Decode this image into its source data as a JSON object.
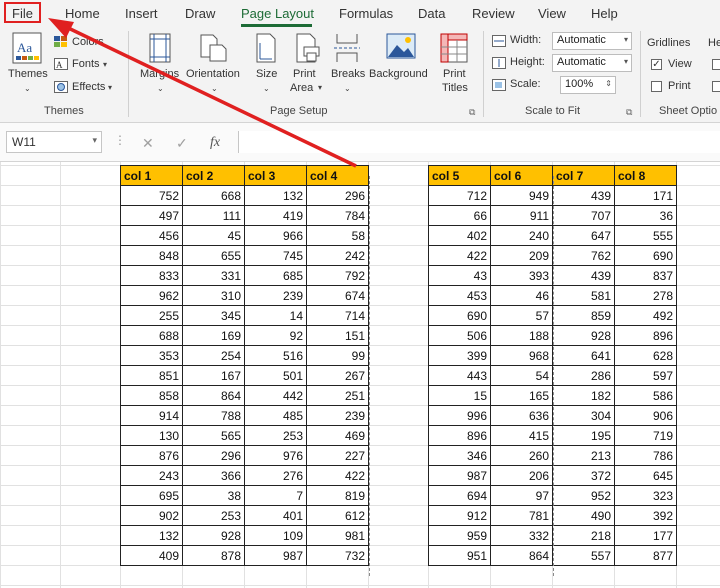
{
  "menu": {
    "file": "File",
    "tabs": [
      "Home",
      "Insert",
      "Draw",
      "Page Layout",
      "Formulas",
      "Data",
      "Review",
      "View",
      "Help"
    ],
    "active": "Page Layout"
  },
  "ribbon": {
    "themes_group": {
      "themes": "Themes",
      "colors": "Colors",
      "fonts": "Fonts",
      "effects": "Effects",
      "label": "Themes"
    },
    "page_setup": {
      "margins": "Margins",
      "orientation": "Orientation",
      "size": "Size",
      "print_area_1": "Print",
      "print_area_2": "Area",
      "breaks": "Breaks",
      "background": "Background",
      "print_titles_1": "Print",
      "print_titles_2": "Titles",
      "label": "Page Setup"
    },
    "scale_to_fit": {
      "width_label": "Width:",
      "width_value": "Automatic",
      "height_label": "Height:",
      "height_value": "Automatic",
      "scale_label": "Scale:",
      "scale_value": "100%",
      "label": "Scale to Fit"
    },
    "sheet_options": {
      "gridlines": "Gridlines",
      "headings_partial": "He",
      "view": "View",
      "print": "Print",
      "label": "Sheet Optio"
    }
  },
  "formula_bar": {
    "name_box": "W11",
    "cancel": "✕",
    "enter": "✓",
    "fx": "fx"
  },
  "table1": {
    "headers": [
      "col 1",
      "col 2",
      "col 3",
      "col 4"
    ],
    "rows": [
      [
        752,
        668,
        132,
        296
      ],
      [
        497,
        111,
        419,
        784
      ],
      [
        456,
        45,
        966,
        58
      ],
      [
        848,
        655,
        745,
        242
      ],
      [
        833,
        331,
        685,
        792
      ],
      [
        962,
        310,
        239,
        674
      ],
      [
        255,
        345,
        14,
        714
      ],
      [
        688,
        169,
        92,
        151
      ],
      [
        353,
        254,
        516,
        99
      ],
      [
        851,
        167,
        501,
        267
      ],
      [
        858,
        864,
        442,
        251
      ],
      [
        914,
        788,
        485,
        239
      ],
      [
        130,
        565,
        253,
        469
      ],
      [
        876,
        296,
        976,
        227
      ],
      [
        243,
        366,
        276,
        422
      ],
      [
        695,
        38,
        7,
        819
      ],
      [
        902,
        253,
        401,
        612
      ],
      [
        132,
        928,
        109,
        981
      ],
      [
        409,
        878,
        987,
        732
      ]
    ]
  },
  "table2": {
    "headers": [
      "col 5",
      "col 6",
      "col 7",
      "col 8"
    ],
    "rows": [
      [
        712,
        949,
        439,
        171
      ],
      [
        66,
        911,
        707,
        36
      ],
      [
        402,
        240,
        647,
        555
      ],
      [
        422,
        209,
        762,
        690
      ],
      [
        43,
        393,
        439,
        837
      ],
      [
        453,
        46,
        581,
        278
      ],
      [
        690,
        57,
        859,
        492
      ],
      [
        506,
        188,
        928,
        896
      ],
      [
        399,
        968,
        641,
        628
      ],
      [
        443,
        54,
        286,
        597
      ],
      [
        15,
        165,
        182,
        586
      ],
      [
        996,
        636,
        304,
        906
      ],
      [
        896,
        415,
        195,
        719
      ],
      [
        346,
        260,
        213,
        786
      ],
      [
        987,
        206,
        372,
        645
      ],
      [
        694,
        97,
        952,
        323
      ],
      [
        912,
        781,
        490,
        392
      ],
      [
        959,
        332,
        218,
        177
      ],
      [
        951,
        864,
        557,
        877
      ]
    ]
  },
  "colors": {
    "accent": "#1d6b36",
    "header_fill": "#ffc000",
    "annotation": "#e02020"
  }
}
